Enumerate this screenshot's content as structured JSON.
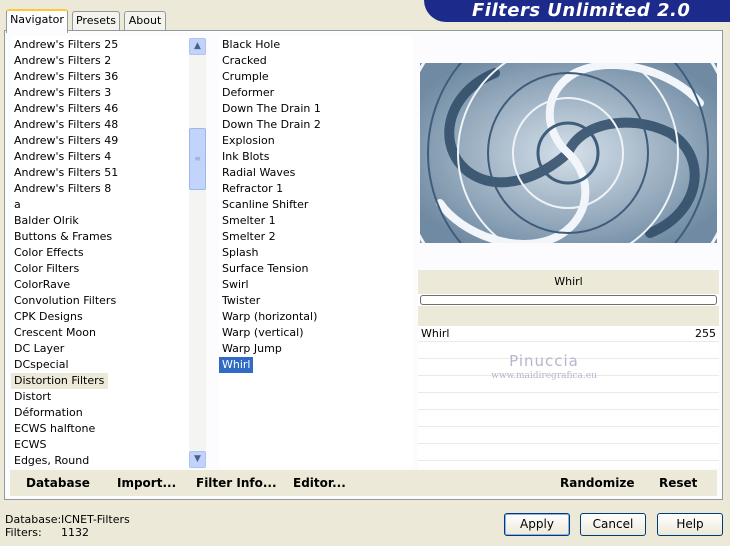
{
  "app": {
    "title": "Filters Unlimited 2.0"
  },
  "tabs": [
    {
      "label": "Navigator",
      "active": true
    },
    {
      "label": "Presets",
      "active": false
    },
    {
      "label": "About",
      "active": false
    }
  ],
  "categories": [
    "Andrew's Filters 25",
    "Andrew's Filters 2",
    "Andrew's Filters 36",
    "Andrew's Filters 3",
    "Andrew's Filters 46",
    "Andrew's Filters 48",
    "Andrew's Filters 49",
    "Andrew's Filters 4",
    "Andrew's Filters 51",
    "Andrew's Filters 8",
    "a",
    "Balder Olrik",
    "Buttons & Frames",
    "Color Effects",
    "Color Filters",
    "ColorRave",
    "Convolution Filters",
    "CPK Designs",
    "Crescent Moon",
    "DC Layer",
    "DCspecial",
    "Distortion Filters",
    "Distort",
    "Déformation",
    "ECWS halftone",
    "ECWS",
    "Edges, Round"
  ],
  "selected_category": "Distortion Filters",
  "filters": [
    "Black Hole",
    "Cracked",
    "Crumple",
    "Deformer",
    "Down The Drain 1",
    "Down The Drain 2",
    "Explosion",
    "Ink Blots",
    "Radial Waves",
    "Refractor 1",
    "Scanline Shifter",
    "Smelter 1",
    "Smelter 2",
    "Splash",
    "Surface Tension",
    "Swirl",
    "Twister",
    "Warp (horizontal)",
    "Warp (vertical)",
    "Warp Jump",
    "Whirl"
  ],
  "selected_filter": "Whirl",
  "preview": {
    "filter_name": "Whirl"
  },
  "controls": [
    {
      "name": "Whirl",
      "value": "255"
    }
  ],
  "watermark": {
    "name": "Pinuccia",
    "url": "www.maidiregrafica.eu"
  },
  "bottom_actions": {
    "database": "Database",
    "import": "Import...",
    "filter_info": "Filter Info...",
    "editor": "Editor...",
    "randomize": "Randomize",
    "reset": "Reset"
  },
  "status": {
    "database_label": "Database:",
    "database_value": "ICNET-Filters",
    "filters_label": "Filters:",
    "filters_value": "1132"
  },
  "buttons": {
    "apply": "Apply",
    "cancel": "Cancel",
    "help": "Help"
  },
  "scrollbar": {
    "up": "▲",
    "down": "▼",
    "grip": "≡"
  },
  "colors": {
    "banner": "#1c2a8c",
    "selection": "#316ac5",
    "preview_tint": "#5a7893"
  }
}
